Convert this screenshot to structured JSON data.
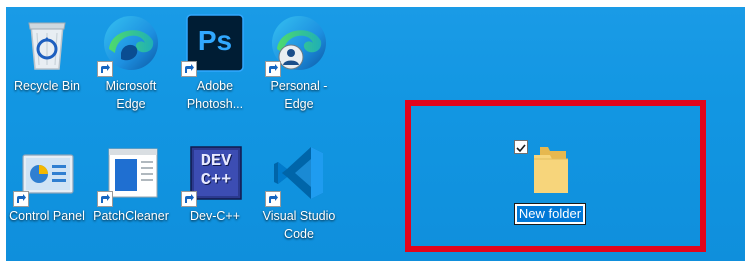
{
  "desktop": {
    "icons": [
      {
        "name": "recycle-bin",
        "label": "Recycle Bin",
        "icon": "recycle-bin-icon",
        "shortcut": false
      },
      {
        "name": "microsoft-edge",
        "label": "Microsoft\nEdge",
        "icon": "edge-icon",
        "shortcut": true
      },
      {
        "name": "adobe-photoshop",
        "label": "Adobe\nPhotosh...",
        "icon": "photoshop-icon",
        "shortcut": true,
        "icon_text": "Ps"
      },
      {
        "name": "personal-edge",
        "label": "Personal -\nEdge",
        "icon": "edge-profile-icon",
        "shortcut": true
      },
      {
        "name": "control-panel",
        "label": "Control Panel",
        "icon": "control-panel-icon",
        "shortcut": true
      },
      {
        "name": "patchcleaner",
        "label": "PatchCleaner",
        "icon": "patchcleaner-icon",
        "shortcut": true
      },
      {
        "name": "dev-cpp",
        "label": "Dev-C++",
        "icon": "devcpp-icon",
        "shortcut": true,
        "icon_text": "DEV\nC++"
      },
      {
        "name": "visual-studio-code",
        "label": "Visual Studio\nCode",
        "icon": "vscode-icon",
        "shortcut": true
      }
    ],
    "new_folder": {
      "label": "New folder",
      "checked": true,
      "icon": "folder-icon"
    }
  },
  "colors": {
    "desktop_bg": "#1296e2",
    "highlight": "#e3041b",
    "selection": "#0078d7"
  }
}
